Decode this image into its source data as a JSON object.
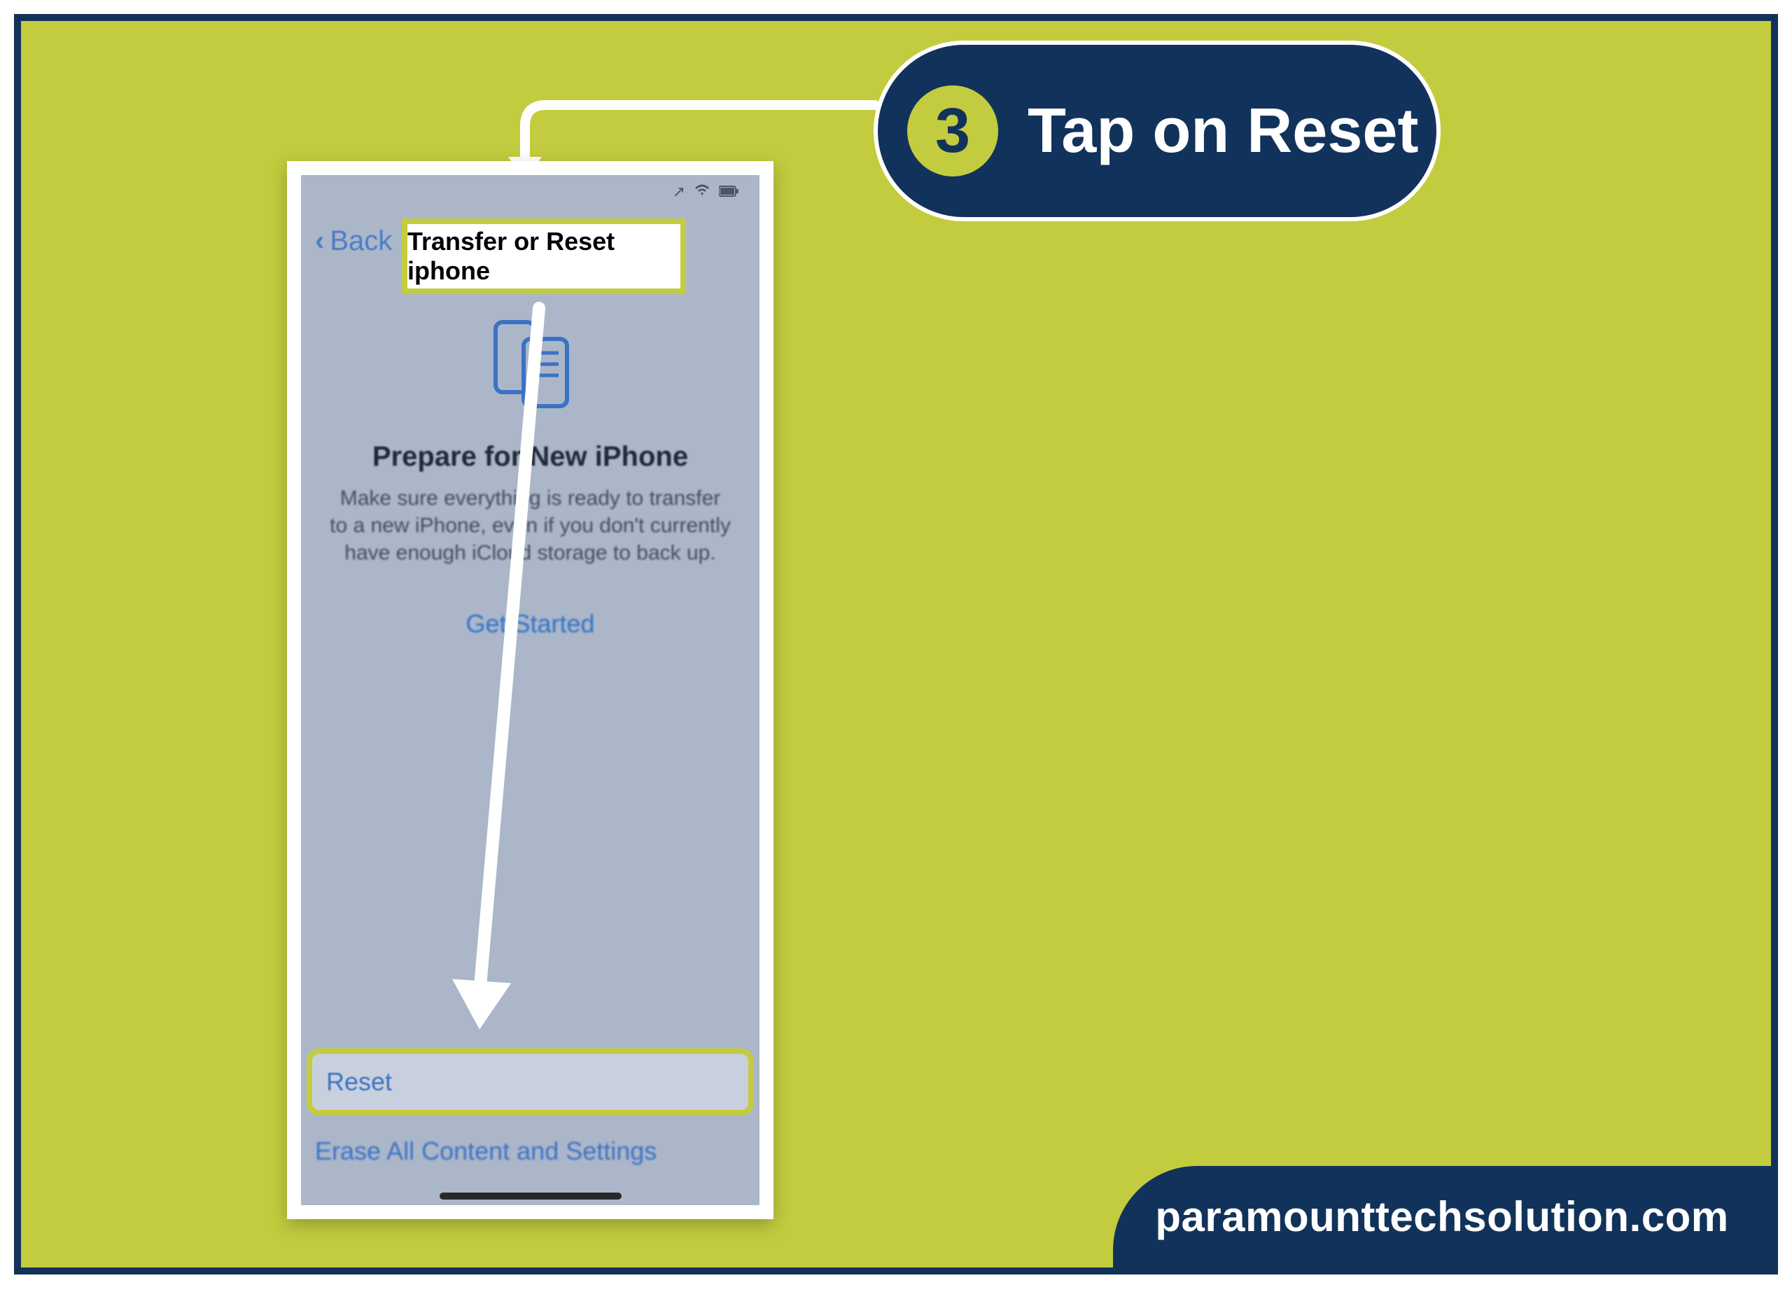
{
  "step": {
    "number": "3",
    "title": "Tap on Reset"
  },
  "phone": {
    "back_label": "Back",
    "page_title_box": "Transfer or Reset iphone",
    "prepare_heading": "Prepare for New iPhone",
    "prepare_desc": "Make sure everything is ready to transfer to a new iPhone, even if you don't currently have enough iCloud storage to back up.",
    "get_started": "Get Started",
    "reset_label": "Reset",
    "erase_label": "Erase All Content and Settings"
  },
  "brand": {
    "site": "paramounttechsolution.com"
  },
  "colors": {
    "bg": "#c3cc3e",
    "navy": "#11335b",
    "link_blue": "#3b72c4"
  }
}
